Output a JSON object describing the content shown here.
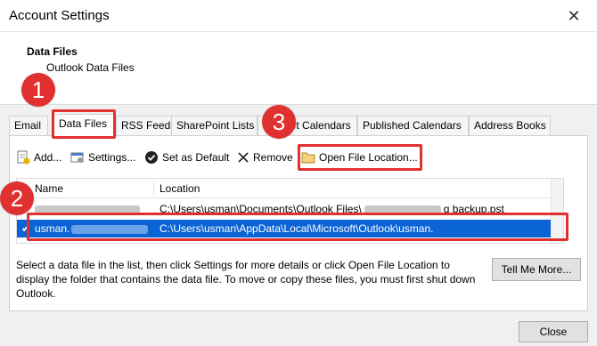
{
  "window": {
    "title": "Account Settings"
  },
  "header": {
    "title": "Data Files",
    "subtitle": "Outlook Data Files"
  },
  "tabs": [
    {
      "label": "Email"
    },
    {
      "label": "Data Files"
    },
    {
      "label": "RSS Feeds"
    },
    {
      "label": "SharePoint Lists"
    },
    {
      "label": "Internet Calendars"
    },
    {
      "label": "Published Calendars"
    },
    {
      "label": "Address Books"
    }
  ],
  "toolbar": {
    "add": "Add...",
    "settings": "Settings...",
    "set_default": "Set as Default",
    "remove": "Remove",
    "open_location": "Open File Location..."
  },
  "list": {
    "columns": {
      "name": "Name",
      "location": "Location"
    },
    "rows": [
      {
        "name": "",
        "location": "C:\\Users\\usman\\Documents\\Outlook Files\\",
        "location_tail": "g backup.pst"
      },
      {
        "name": "usman.",
        "location": "C:\\Users\\usman\\AppData\\Local\\Microsoft\\Outlook\\usman.",
        "selected": true
      }
    ]
  },
  "description": "Select a data file in the list, then click Settings for more details or click Open File Location to display the folder that contains the data file. To move or copy these files, you must first shut down Outlook.",
  "buttons": {
    "tell_me": "Tell Me More...",
    "close": "Close"
  },
  "annotations": {
    "step1": "1",
    "step2": "2",
    "step3": "3"
  },
  "colors": {
    "accent_red": "#e0302f",
    "selection_blue": "#0a64d6"
  }
}
